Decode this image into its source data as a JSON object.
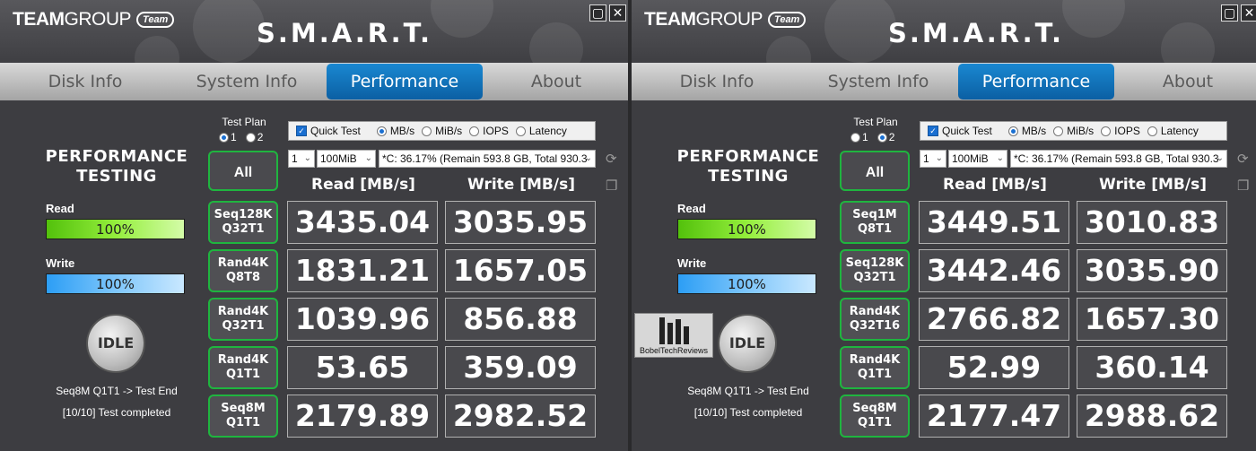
{
  "window_buttons": {
    "minimize": "▢",
    "close": "✕"
  },
  "panels": [
    {
      "logo": {
        "brand_bold": "TEAM",
        "brand_light": "GROUP",
        "badge": "Team"
      },
      "title": "S.M.A.R.T.",
      "tabs": [
        "Disk Info",
        "System Info",
        "Performance",
        "About"
      ],
      "active_tab": "Performance",
      "performance_title": "PERFORMANCE TESTING",
      "progress": {
        "read": {
          "label": "Read",
          "text": "100%",
          "value_percent": 100
        },
        "write": {
          "label": "Write",
          "text": "100%",
          "value_percent": 100
        }
      },
      "idle_label": "IDLE",
      "status_line1": "Seq8M Q1T1 -> Test End",
      "status_line2": "[10/10] Test completed",
      "test_plan": {
        "label": "Test Plan",
        "options": [
          "1",
          "2"
        ],
        "selected": "1"
      },
      "options": {
        "quick_test": "Quick Test",
        "quick_test_checked": true,
        "units": [
          "MB/s",
          "MiB/s",
          "IOPS",
          "Latency"
        ],
        "selected_unit": "MB/s"
      },
      "count_select": "1",
      "size_select": "100MiB",
      "drive_select": "*C: 36.17% (Remain 593.8 GB, Total 930.3",
      "all_button": "All",
      "columns": {
        "read": "Read [MB/s]",
        "write": "Write [MB/s]"
      },
      "tests": [
        {
          "line1": "Seq128K",
          "line2": "Q32T1",
          "read": "3435.04",
          "write": "3035.95"
        },
        {
          "line1": "Rand4K",
          "line2": "Q8T8",
          "read": "1831.21",
          "write": "1657.05"
        },
        {
          "line1": "Rand4K",
          "line2": "Q32T1",
          "read": "1039.96",
          "write": "856.88"
        },
        {
          "line1": "Rand4K",
          "line2": "Q1T1",
          "read": "53.65",
          "write": "359.09"
        },
        {
          "line1": "Seq8M",
          "line2": "Q1T1",
          "read": "2179.89",
          "write": "2982.52"
        }
      ]
    },
    {
      "logo": {
        "brand_bold": "TEAM",
        "brand_light": "GROUP",
        "badge": "Team"
      },
      "title": "S.M.A.R.T.",
      "tabs": [
        "Disk Info",
        "System Info",
        "Performance",
        "About"
      ],
      "active_tab": "Performance",
      "performance_title": "PERFORMANCE TESTING",
      "progress": {
        "read": {
          "label": "Read",
          "text": "100%",
          "value_percent": 100
        },
        "write": {
          "label": "Write",
          "text": "100%",
          "value_percent": 100
        }
      },
      "idle_label": "IDLE",
      "status_line1": "Seq8M Q1T1 -> Test End",
      "status_line2": "[10/10] Test completed",
      "test_plan": {
        "label": "Test Plan",
        "options": [
          "1",
          "2"
        ],
        "selected": "2"
      },
      "options": {
        "quick_test": "Quick Test",
        "quick_test_checked": true,
        "units": [
          "MB/s",
          "MiB/s",
          "IOPS",
          "Latency"
        ],
        "selected_unit": "MB/s"
      },
      "count_select": "1",
      "size_select": "100MiB",
      "drive_select": "*C: 36.17% (Remain 593.8 GB, Total 930.3",
      "all_button": "All",
      "columns": {
        "read": "Read [MB/s]",
        "write": "Write [MB/s]"
      },
      "tests": [
        {
          "line1": "Seq1M",
          "line2": "Q8T1",
          "read": "3449.51",
          "write": "3010.83"
        },
        {
          "line1": "Seq128K",
          "line2": "Q32T1",
          "read": "3442.46",
          "write": "3035.90"
        },
        {
          "line1": "Rand4K",
          "line2": "Q32T16",
          "read": "2766.82",
          "write": "1657.30"
        },
        {
          "line1": "Rand4K",
          "line2": "Q1T1",
          "read": "52.99",
          "write": "360.14"
        },
        {
          "line1": "Seq8M",
          "line2": "Q1T1",
          "read": "2177.47",
          "write": "2988.62"
        }
      ]
    }
  ],
  "watermark": {
    "text": "BobelTechReviews"
  },
  "colors": {
    "accent_blue": "#0f6fb8",
    "button_border_green": "#1fb53f",
    "read_bar": "#6fd52b",
    "write_bar": "#55b4f8"
  }
}
